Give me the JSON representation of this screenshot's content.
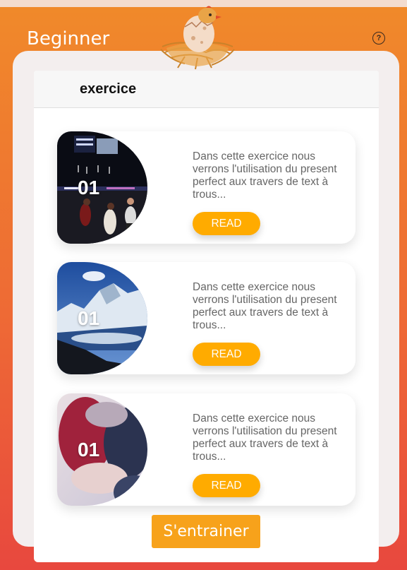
{
  "app": {
    "level_title": "Beginner",
    "help_icon": "question-circle-icon",
    "mascot": "chick-in-nest-icon"
  },
  "section": {
    "title": "exercice"
  },
  "exercises": [
    {
      "number": "01",
      "description": "Dans cette exercice nous verrons l'utilisation du present perfect aux travers de text à trous...",
      "read_label": "READ",
      "image": "basketball-game-photo"
    },
    {
      "number": "01",
      "description": "Dans cette exercice nous verrons l'utilisation du present perfect aux travers de text à trous...",
      "read_label": "READ",
      "image": "snowy-mountains-photo"
    },
    {
      "number": "01",
      "description": "Dans cette exercice nous verrons l'utilisation du present perfect aux travers de text à trous...",
      "read_label": "READ",
      "image": "blurred-red-photo"
    }
  ],
  "train_button": "S'entrainer",
  "colors": {
    "accent": "#ffab00",
    "train": "#f7a21b",
    "gradient_top": "#f08a2a",
    "gradient_bottom": "#e8483e"
  }
}
